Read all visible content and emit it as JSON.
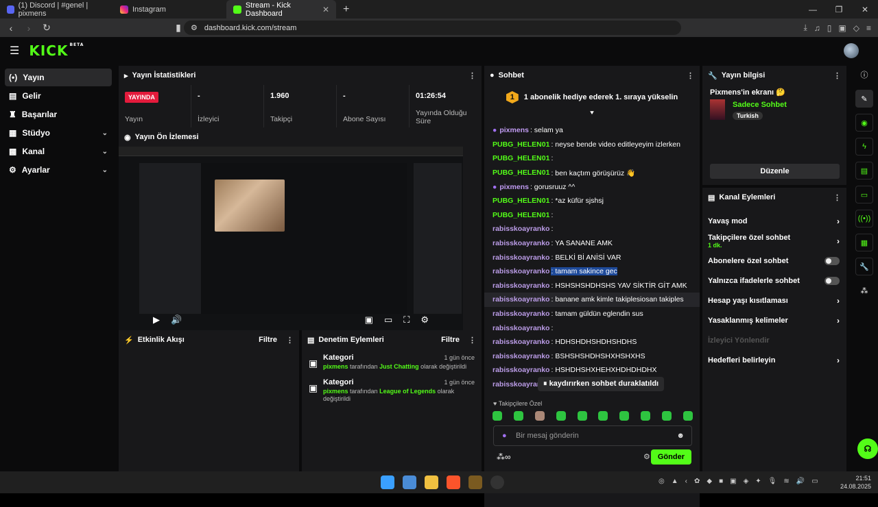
{
  "browser": {
    "tabs": [
      {
        "label": "(1) Discord | #genel | pixmens"
      },
      {
        "label": "Instagram"
      },
      {
        "label": "Stream - Kick Dashboard",
        "active": true
      }
    ],
    "url": "dashboard.kick.com/stream"
  },
  "logo": "KICK",
  "logo_sup": "BETA",
  "sidebar": {
    "items": [
      {
        "label": "Yayın",
        "icon": "broadcast-icon"
      },
      {
        "label": "Gelir",
        "icon": "wallet-icon"
      },
      {
        "label": "Başarılar",
        "icon": "trophy-icon"
      },
      {
        "label": "Stüdyo",
        "icon": "studio-icon"
      },
      {
        "label": "Kanal",
        "icon": "channel-icon"
      },
      {
        "label": "Ayarlar",
        "icon": "gear-icon"
      }
    ]
  },
  "stats": {
    "title": "Yayın İstatistikleri",
    "live_badge": "YAYINDA",
    "items": [
      {
        "value": "",
        "label": "Yayın"
      },
      {
        "value": "-",
        "label": "İzleyici"
      },
      {
        "value": "1.960",
        "label": "Takipçi"
      },
      {
        "value": "-",
        "label": "Abone Sayısı"
      },
      {
        "value": "01:26:54",
        "label": "Yayında Olduğu Süre"
      }
    ]
  },
  "preview": {
    "title": "Yayın Ön İzlemesi"
  },
  "activity": {
    "title": "Etkinlik Akışı",
    "filter": "Filtre"
  },
  "moderation": {
    "title": "Denetim Eylemleri",
    "filter": "Filtre",
    "items": [
      {
        "title": "Kategori",
        "time": "1 gün önce",
        "user": "pixmens",
        "mid": "tarafından",
        "cat": "Just Chatting",
        "end": "olarak değiştirildi"
      },
      {
        "title": "Kategori",
        "time": "1 gün önce",
        "user": "pixmens",
        "mid": "tarafından",
        "cat": "League of Legends",
        "end": "olarak değiştirildi"
      }
    ]
  },
  "chat": {
    "title": "Sohbet",
    "pinned_rank": "1",
    "pinned": "1 abonelik hediye ederek 1. sıraya yükselin",
    "messages": [
      {
        "user": "pixmens",
        "text": "selam ya",
        "c": "up",
        "mic": true
      },
      {
        "user": "PUBG_HELEN01",
        "text": "neyse bende video editleyeyim izlerken",
        "c": "ug"
      },
      {
        "user": "PUBG_HELEN01",
        "text": "",
        "c": "ug"
      },
      {
        "user": "PUBG_HELEN01",
        "text": "ben kaçtım görüşürüz 👋",
        "c": "ug"
      },
      {
        "user": "pixmens",
        "text": "gorusruuz ^^",
        "c": "up",
        "mic": true
      },
      {
        "user": "PUBG_HELEN01",
        "text": "*az küfür sjshsj",
        "c": "ug"
      },
      {
        "user": "PUBG_HELEN01",
        "text": "",
        "c": "ug"
      },
      {
        "user": "rabisskoayranko",
        "text": "",
        "c": "ur"
      },
      {
        "user": "rabisskoayranko",
        "text": "YA SANANE AMK",
        "c": "ur"
      },
      {
        "user": "rabisskoayranko",
        "text": "BELKİ Bİ ANİSİ VAR",
        "c": "ur"
      },
      {
        "user": "rabisskoayranko",
        "text": "tamam sakince gec",
        "c": "ur",
        "hl": true
      },
      {
        "user": "rabisskoayranko",
        "text": "HSHSHSHDHSHS YAV SİKTİR GİT AMK",
        "c": "ur"
      },
      {
        "user": "rabisskoayranko",
        "text": "banane amk kimle takiplesiosan takiples",
        "c": "ur",
        "hover": true
      },
      {
        "user": "rabisskoayranko",
        "text": "tamam güldün eglendin sus",
        "c": "ur"
      },
      {
        "user": "rabisskoayranko",
        "text": "",
        "c": "ur"
      },
      {
        "user": "rabisskoayranko",
        "text": "HDHSHDHSHDHSHDHS",
        "c": "ur"
      },
      {
        "user": "rabisskoayranko",
        "text": "BSHSHSHDHSHXHSHXHS",
        "c": "ur"
      },
      {
        "user": "rabisskoayranko",
        "text": "HSHDHSHXHEHXHDHDHDHX",
        "c": "ur"
      },
      {
        "user": "rabisskoayranl",
        "text": "",
        "c": "ur"
      }
    ],
    "paused": "kaydırırken sohbet duraklatıldı",
    "followers_only": "Takipçilere Özel",
    "placeholder": "Bir mesaj gönderin",
    "send": "Gönder"
  },
  "info": {
    "title": "Yayın bilgisi",
    "screen": "Pixmens'in ekranı 🤔",
    "mode": "Sadece Sohbet",
    "lang": "Turkish",
    "edit": "Düzenle"
  },
  "actions": {
    "title": "Kanal Eylemleri",
    "items": [
      {
        "label": "Yavaş mod",
        "type": "arrow"
      },
      {
        "label": "Takipçilere özel sohbet",
        "sub": "1 dk.",
        "type": "arrow"
      },
      {
        "label": "Abonelere özel sohbet",
        "type": "toggle"
      },
      {
        "label": "Yalnızca ifadelerle sohbet",
        "type": "toggle"
      },
      {
        "label": "Hesap yaşı kısıtlaması",
        "type": "arrow"
      },
      {
        "label": "Yasaklanmış kelimeler",
        "type": "arrow"
      },
      {
        "label": "İzleyici Yönlendir",
        "type": "disabled"
      },
      {
        "label": "Hedefleri belirleyin",
        "type": "arrow"
      }
    ]
  },
  "taskbar": {
    "time": "21:51",
    "date": "24.08.2025"
  }
}
